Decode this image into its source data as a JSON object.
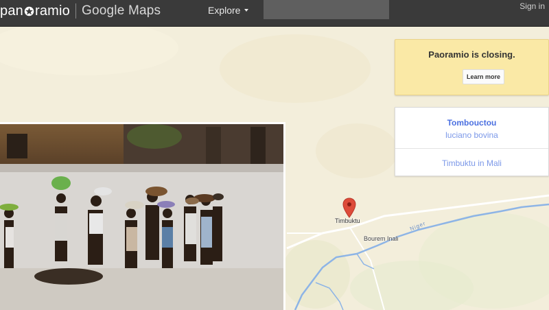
{
  "header": {
    "logo_text": "panoramio",
    "brand_suffix": "Google Maps",
    "explore_label": "Explore",
    "search_value": "",
    "signin_label": "Sign in"
  },
  "notice": {
    "title": "Paoramio is closing.",
    "button_label": "Learn more"
  },
  "photo_card": {
    "photo_title": "Tombouctou",
    "author": "luciano bovina",
    "group": "Timbuktu in Mali"
  },
  "map": {
    "place_label": "Timbuktu",
    "town_label": "Bourem Inali",
    "river_label": "Niger",
    "colors": {
      "land": "#f3eedb",
      "water": "#8db4e6",
      "road": "#ffffff",
      "pin": "#dd4b39",
      "header": "#3a3a3a",
      "notice_bg": "#fae9a6",
      "link": "#4a6fe0"
    }
  },
  "icons": {
    "logo_star": "star-icon",
    "dropdown": "caret-down-icon",
    "map_marker": "map-pin-icon"
  }
}
